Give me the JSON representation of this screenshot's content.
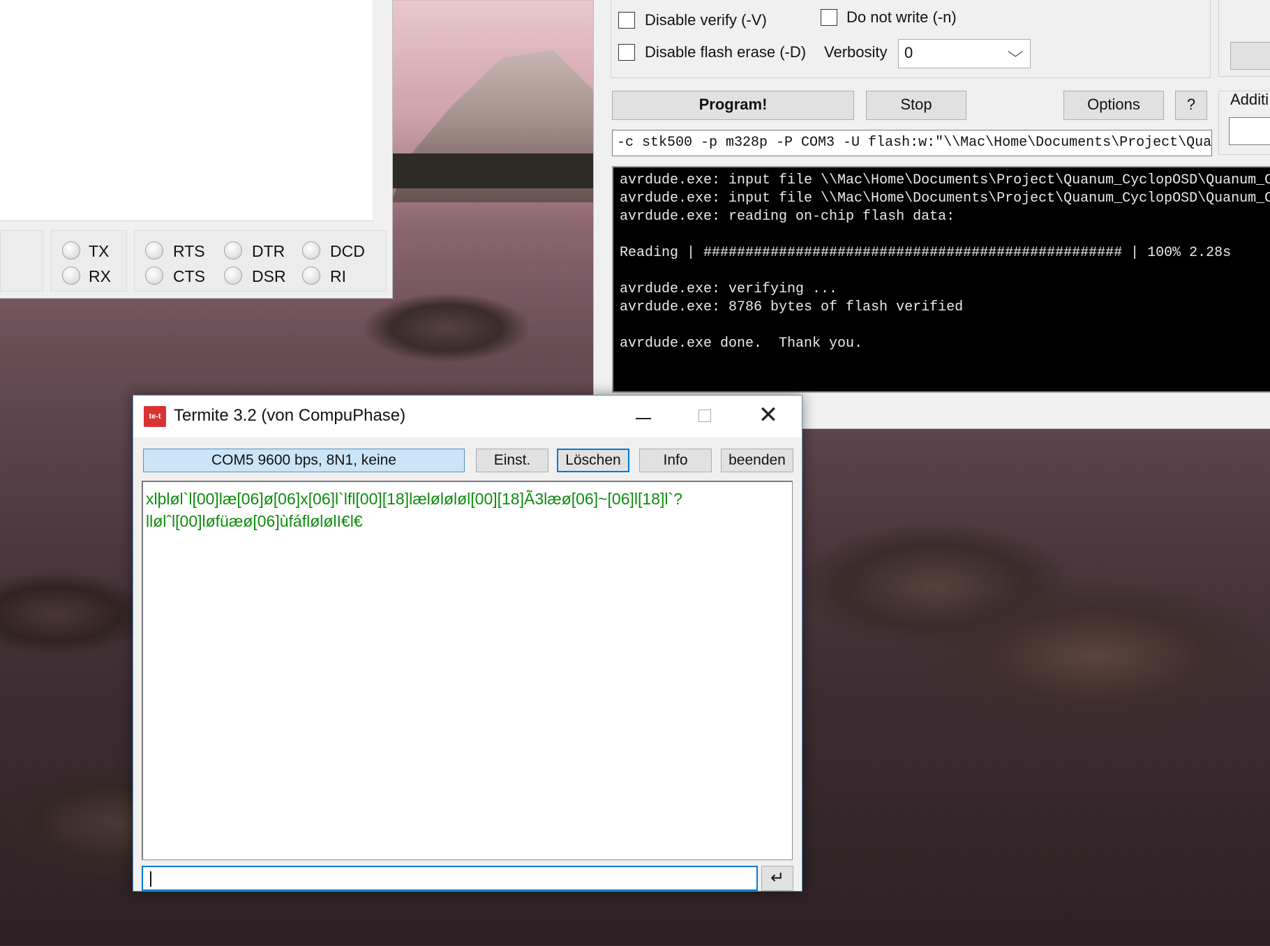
{
  "left_window": {
    "signals": {
      "tx": "TX",
      "rx": "RX",
      "rts": "RTS",
      "cts": "CTS",
      "dtr": "DTR",
      "dsr": "DSR",
      "dcd": "DCD",
      "ri": "RI"
    }
  },
  "avrdude_window": {
    "disable_verify": "Disable verify (-V)",
    "do_not_write": "Do not write (-n)",
    "disable_flash_erase": "Disable flash erase (-D)",
    "verbosity_label": "Verbosity",
    "verbosity_value": "0",
    "program_button": "Program!",
    "stop_button": "Stop",
    "options_button": "Options",
    "help_button": "?",
    "additional_label": "Additi",
    "command_line": "-c stk500 -p m328p -P COM3 -U flash:w:\"\\\\Mac\\Home\\Documents\\Project\\Qua",
    "console_lines": [
      "avrdude.exe: input file \\\\Mac\\Home\\Documents\\Project\\Quanum_CyclopOSD\\Quanum_C",
      "avrdude.exe: input file \\\\Mac\\Home\\Documents\\Project\\Quanum_CyclopOSD\\Quanum_C",
      "avrdude.exe: reading on-chip flash data:",
      "",
      "Reading | ################################################## | 100% 2.28s",
      "",
      "avrdude.exe: verifying ...",
      "avrdude.exe: 8786 bytes of flash verified",
      "",
      "avrdude.exe done.  Thank you."
    ]
  },
  "termite": {
    "title": "Termite 3.2 (von CompuPhase)",
    "icon_text": "te-t",
    "port_status": "COM5 9600 bps, 8N1, keine",
    "settings_button": "Einst.",
    "clear_button": "Löschen",
    "info_button": "Info",
    "quit_button": "beenden",
    "received_lines": [
      "xlþløl`l[00]læ[06]ø[06]x[06]l`lfl[00][18]læløløløl[00][18]Ã3læø[06]~[06]l[18]l`?",
      "llølˆl[00]løfüæø[06]ùfáflølølI€l€"
    ],
    "send_value": "",
    "enter_glyph": "↵"
  }
}
